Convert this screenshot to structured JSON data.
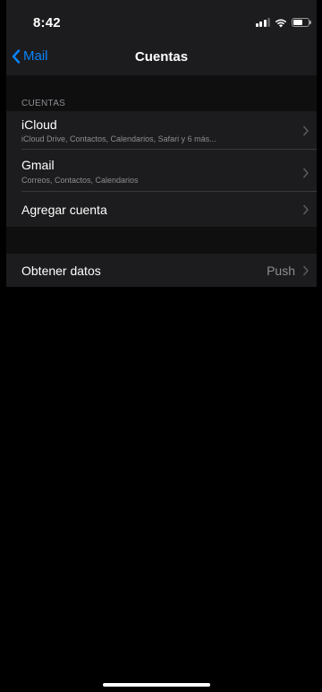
{
  "status_bar": {
    "time": "8:42"
  },
  "nav": {
    "back_label": "Mail",
    "title": "Cuentas"
  },
  "section": {
    "header": "CUENTAS"
  },
  "accounts": [
    {
      "title": "iCloud",
      "subtitle": "iCloud Drive, Contactos, Calendarios, Safari y 6 más..."
    },
    {
      "title": "Gmail",
      "subtitle": "Correos, Contactos, Calendarios"
    }
  ],
  "add_account": {
    "label": "Agregar cuenta"
  },
  "fetch": {
    "label": "Obtener datos",
    "value": "Push"
  },
  "colors": {
    "accent": "#0a84ff",
    "background": "#000000",
    "cell": "#1c1c1e",
    "secondary_text": "#8d8d93"
  }
}
